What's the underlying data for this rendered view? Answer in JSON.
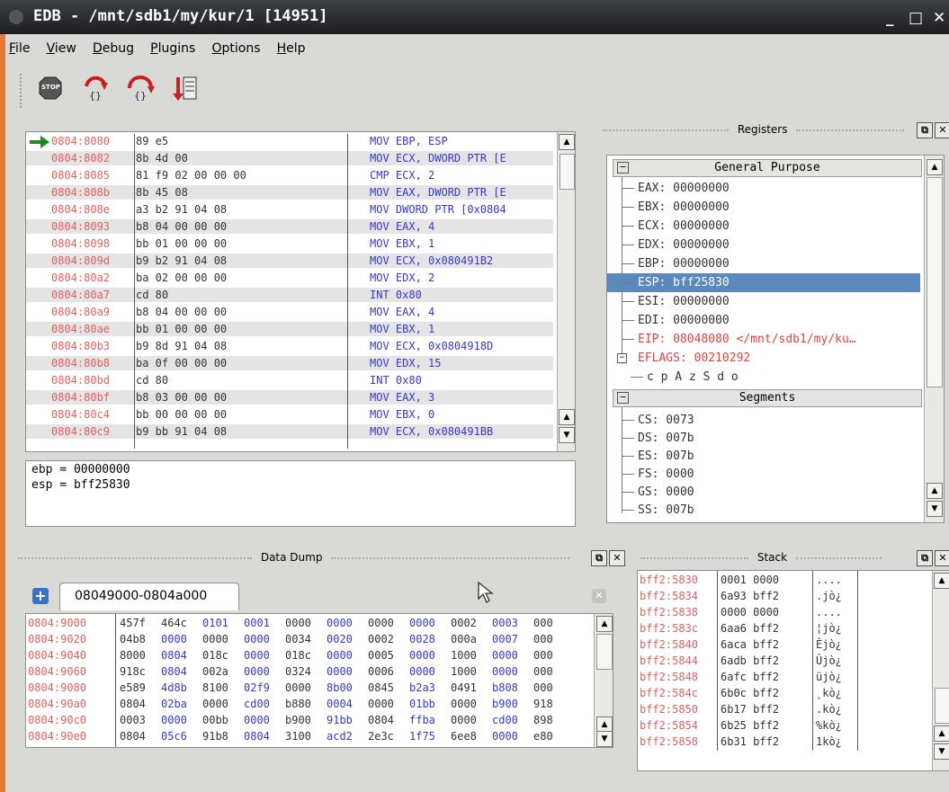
{
  "window": {
    "title": "EDB - /mnt/sdb1/my/kur/1 [14951]",
    "min": "_",
    "max": "□",
    "close": "✕"
  },
  "menu": [
    "File",
    "View",
    "Debug",
    "Plugins",
    "Options",
    "Help"
  ],
  "toolbar": {
    "stop_label": "STOP"
  },
  "disasm": {
    "rows": [
      {
        "addr": "0804:8080",
        "bytes": "89 e5",
        "ins": "MOV EBP, ESP"
      },
      {
        "addr": "0804:8082",
        "bytes": "8b 4d 00",
        "ins": "MOV ECX, DWORD PTR [E"
      },
      {
        "addr": "0804:8085",
        "bytes": "81 f9 02 00 00 00",
        "ins": "CMP ECX, 2"
      },
      {
        "addr": "0804:808b",
        "bytes": "8b 45 08",
        "ins": "MOV EAX, DWORD PTR [E"
      },
      {
        "addr": "0804:808e",
        "bytes": "a3 b2 91 04 08",
        "ins": "MOV DWORD PTR [0x0804"
      },
      {
        "addr": "0804:8093",
        "bytes": "b8 04 00 00 00",
        "ins": "MOV EAX, 4"
      },
      {
        "addr": "0804:8098",
        "bytes": "bb 01 00 00 00",
        "ins": "MOV EBX, 1"
      },
      {
        "addr": "0804:809d",
        "bytes": "b9 b2 91 04 08",
        "ins": "MOV ECX, 0x080491B2"
      },
      {
        "addr": "0804:80a2",
        "bytes": "ba 02 00 00 00",
        "ins": "MOV EDX, 2"
      },
      {
        "addr": "0804:80a7",
        "bytes": "cd 80",
        "ins": "INT 0x80"
      },
      {
        "addr": "0804:80a9",
        "bytes": "b8 04 00 00 00",
        "ins": "MOV EAX, 4"
      },
      {
        "addr": "0804:80ae",
        "bytes": "bb 01 00 00 00",
        "ins": "MOV EBX, 1"
      },
      {
        "addr": "0804:80b3",
        "bytes": "b9 8d 91 04 08",
        "ins": "MOV ECX, 0x0804918D"
      },
      {
        "addr": "0804:80b8",
        "bytes": "ba 0f 00 00 00",
        "ins": "MOV EDX, 15"
      },
      {
        "addr": "0804:80bd",
        "bytes": "cd 80",
        "ins": "INT 0x80"
      },
      {
        "addr": "0804:80bf",
        "bytes": "b8 03 00 00 00",
        "ins": "MOV EAX, 3"
      },
      {
        "addr": "0804:80c4",
        "bytes": "bb 00 00 00 00",
        "ins": "MOV EBX, 0"
      },
      {
        "addr": "0804:80c9",
        "bytes": "b9 bb 91 04 08",
        "ins": "MOV ECX, 0x080491BB"
      }
    ]
  },
  "info": {
    "line1": "ebp = 00000000",
    "line2": "esp = bff25830"
  },
  "registers": {
    "title": "Registers",
    "general_header": "General Purpose",
    "general": [
      {
        "text": "EAX: 00000000",
        "style": "normal"
      },
      {
        "text": "EBX: 00000000",
        "style": "normal"
      },
      {
        "text": "ECX: 00000000",
        "style": "normal"
      },
      {
        "text": "EDX: 00000000",
        "style": "normal"
      },
      {
        "text": "EBP: 00000000",
        "style": "normal"
      },
      {
        "text": "ESP: bff25830",
        "style": "selected"
      },
      {
        "text": "ESI: 00000000",
        "style": "normal"
      },
      {
        "text": "EDI: 00000000",
        "style": "normal"
      },
      {
        "text": "EIP: 08048080 </mnt/sdb1/my/ku…",
        "style": "red"
      },
      {
        "text": "EFLAGS: 00210292",
        "style": "red"
      },
      {
        "text": "c p A z S d o",
        "style": "normal"
      }
    ],
    "segments_header": "Segments",
    "segments": [
      "CS: 0073",
      "DS: 007b",
      "ES: 007b",
      "FS: 0000",
      "GS: 0000",
      "SS: 007b"
    ]
  },
  "dump": {
    "title": "Data Dump",
    "tab": "08049000-0804a000",
    "rows": [
      {
        "addr": "0804:9000",
        "words": [
          "457f",
          "464c",
          "0101",
          "0001",
          "0000",
          "0000",
          "0000",
          "0000",
          "0002",
          "0003",
          "000"
        ]
      },
      {
        "addr": "0804:9020",
        "words": [
          "04b8",
          "0000",
          "0000",
          "0000",
          "0034",
          "0020",
          "0002",
          "0028",
          "000a",
          "0007",
          "000"
        ]
      },
      {
        "addr": "0804:9040",
        "words": [
          "8000",
          "0804",
          "018c",
          "0000",
          "018c",
          "0000",
          "0005",
          "0000",
          "1000",
          "0000",
          "000"
        ]
      },
      {
        "addr": "0804:9060",
        "words": [
          "918c",
          "0804",
          "002a",
          "0000",
          "0324",
          "0000",
          "0006",
          "0000",
          "1000",
          "0000",
          "000"
        ]
      },
      {
        "addr": "0804:9080",
        "words": [
          "e589",
          "4d8b",
          "8100",
          "02f9",
          "0000",
          "8b00",
          "0845",
          "b2a3",
          "0491",
          "b808",
          "000"
        ]
      },
      {
        "addr": "0804:90a0",
        "words": [
          "0804",
          "02ba",
          "0000",
          "cd00",
          "b880",
          "0004",
          "0000",
          "01bb",
          "0000",
          "b900",
          "918"
        ]
      },
      {
        "addr": "0804:90c0",
        "words": [
          "0003",
          "0000",
          "00bb",
          "0000",
          "b900",
          "91bb",
          "0804",
          "ffba",
          "0000",
          "cd00",
          "898"
        ]
      },
      {
        "addr": "0804:90e0",
        "words": [
          "0804",
          "05c6",
          "91b8",
          "0804",
          "3100",
          "acd2",
          "2e3c",
          "1f75",
          "6ee8",
          "0000",
          "e80"
        ]
      }
    ]
  },
  "stack": {
    "title": "Stack",
    "rows": [
      {
        "addr": "bff2:5830",
        "hex": "0001 0000",
        "ascii": "...."
      },
      {
        "addr": "bff2:5834",
        "hex": "6a93 bff2",
        "ascii": ".jò¿"
      },
      {
        "addr": "bff2:5838",
        "hex": "0000 0000",
        "ascii": "...."
      },
      {
        "addr": "bff2:583c",
        "hex": "6aa6 bff2",
        "ascii": "¦jò¿"
      },
      {
        "addr": "bff2:5840",
        "hex": "6aca bff2",
        "ascii": "Êjò¿"
      },
      {
        "addr": "bff2:5844",
        "hex": "6adb bff2",
        "ascii": "Ûjò¿"
      },
      {
        "addr": "bff2:5848",
        "hex": "6afc bff2",
        "ascii": "üjò¿"
      },
      {
        "addr": "bff2:584c",
        "hex": "6b0c bff2",
        "ascii": "˛kò¿"
      },
      {
        "addr": "bff2:5850",
        "hex": "6b17 bff2",
        "ascii": ".kò¿"
      },
      {
        "addr": "bff2:5854",
        "hex": "6b25 bff2",
        "ascii": "%kò¿"
      },
      {
        "addr": "bff2:5858",
        "hex": "6b31 bff2",
        "ascii": "1kò¿"
      }
    ]
  }
}
